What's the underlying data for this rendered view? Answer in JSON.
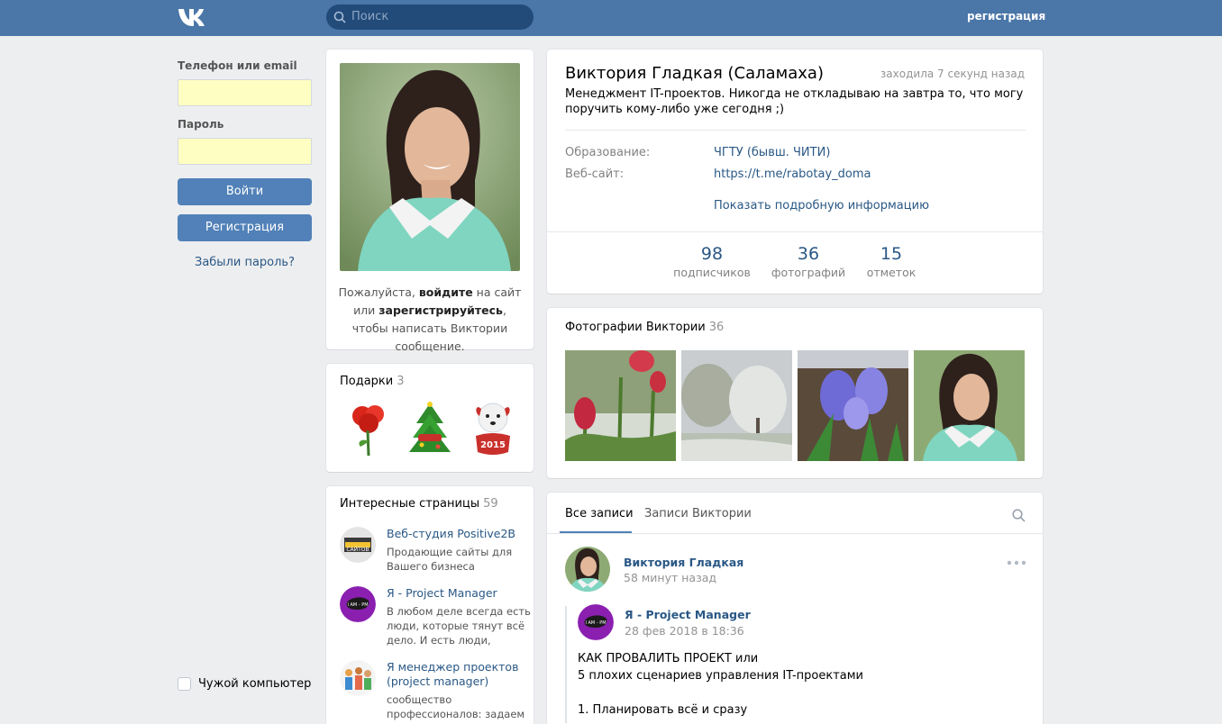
{
  "header": {
    "search_placeholder": "Поиск",
    "register_link": "регистрация"
  },
  "login": {
    "phone_label": "Телефон или email",
    "phone_value": "",
    "password_label": "Пароль",
    "password_value": "",
    "login_button": "Войти",
    "register_button": "Регистрация",
    "forgot_link": "Забыли пароль?",
    "foreign_computer": "Чужой компьютер"
  },
  "avatar_card": {
    "note_part1": "Пожалуйста, ",
    "note_login": "войдите",
    "note_part2": " на сайт или ",
    "note_register": "зарегистрируйтесь",
    "note_part3": ", чтобы написать Виктории сообщение."
  },
  "gifts": {
    "title": "Подарки",
    "count": "3",
    "items": [
      "rose-gift",
      "christmas-tree-gift",
      "dog-2015-gift"
    ]
  },
  "interesting_pages": {
    "title": "Интересные страницы",
    "count": "59",
    "items": [
      {
        "name": "Веб-студия Positive2B",
        "desc": "Продающие сайты для Вашего бизнеса"
      },
      {
        "name": "Я - Project Manager",
        "desc": "В любом деле всегда есть люди, которые тянут всё дело. И есть люди,"
      },
      {
        "name": "Я менеджер проектов (project manager)",
        "desc": "сообщество профессионалов: задаем"
      }
    ]
  },
  "profile": {
    "name": "Виктория Гладкая (Саламаха)",
    "last_seen": "заходила 7 секунд назад",
    "status": "Менеджмент IT-проектов. Никогда не откладываю на завтра то, что могу поручить кому-либо уже сегодня ;)",
    "education_label": "Образование:",
    "education_value": "ЧГТУ (бывш. ЧИТИ)",
    "website_label": "Веб-сайт:",
    "website_value": "https://t.me/rabotay_doma",
    "more_info": "Показать подробную информацию",
    "counters": [
      {
        "value": "98",
        "label": "подписчиков"
      },
      {
        "value": "36",
        "label": "фотографий"
      },
      {
        "value": "15",
        "label": "отметок"
      }
    ]
  },
  "photos": {
    "title": "Фотографии Виктории",
    "count": "36",
    "items": [
      "red-tulips-photo",
      "winter-trees-photo",
      "hyacinths-photo",
      "portrait-photo"
    ]
  },
  "wall": {
    "tab_all": "Все записи",
    "tab_own": "Записи Виктории",
    "post": {
      "author": "Виктория Гладкая",
      "time": "58 минут назад",
      "repost_author": "Я - Project Manager",
      "repost_time": "28 фев 2018 в 18:36",
      "line1": "КАК ПРОВАЛИТЬ ПРОЕКТ или",
      "line2": "5 плохих сценариев управления IT-проектами",
      "line3": "1. Планировать всё и сразу"
    }
  },
  "colors": {
    "header": "#4a76a8",
    "accent": "#5181b8",
    "link": "#2a5885",
    "background": "#edeef0"
  }
}
